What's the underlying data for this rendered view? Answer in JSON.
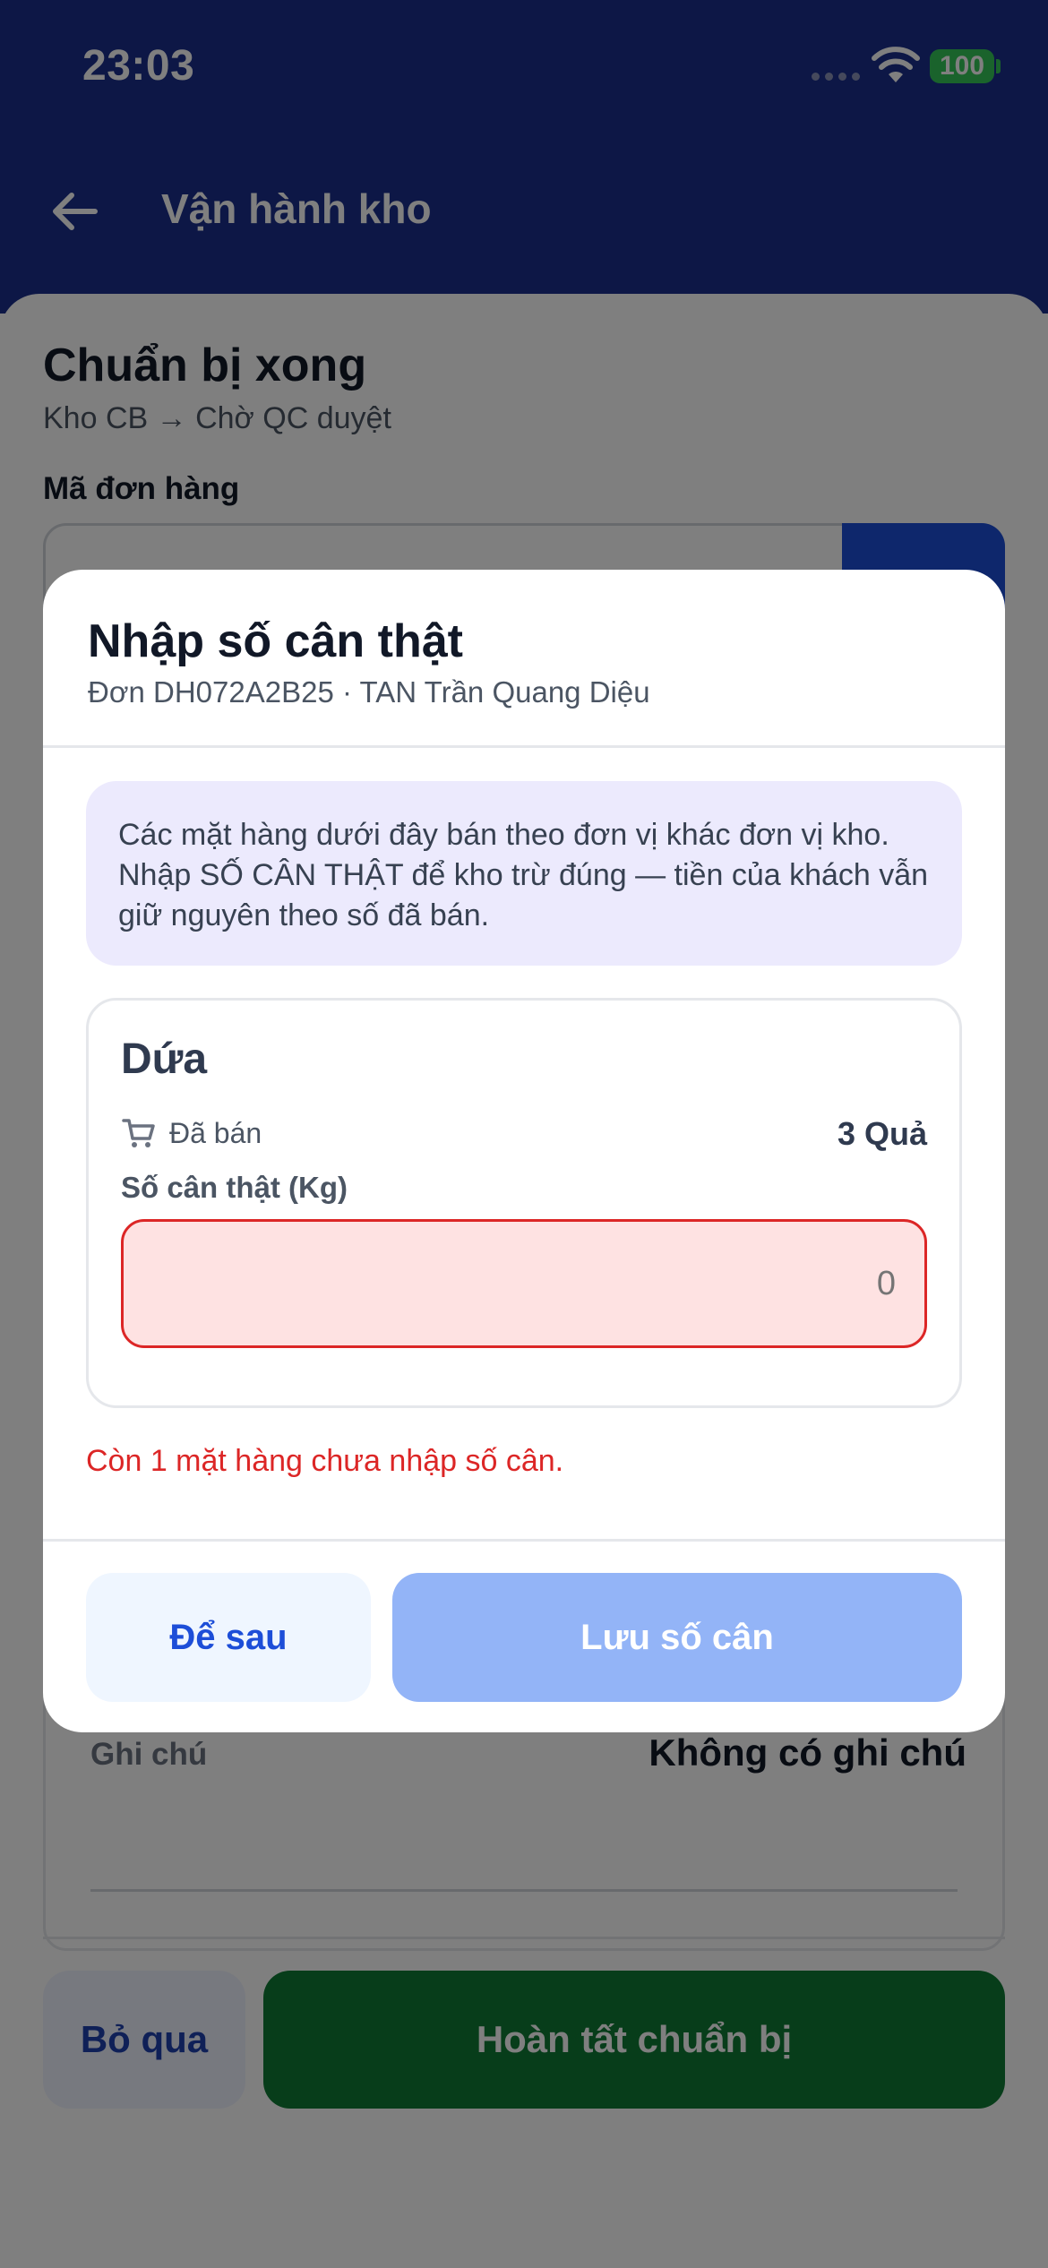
{
  "status_bar": {
    "time": "23:03",
    "battery": "100"
  },
  "header": {
    "title": "Vận hành kho"
  },
  "page": {
    "title": "Chuẩn bị xong",
    "subtitle": "Kho CB → Chờ QC duyệt",
    "order_label": "Mã đơn hàng",
    "note_label": "Ghi chú",
    "note_value": "Không có ghi chú",
    "skip_label": "Bỏ qua",
    "complete_label": "Hoàn tất chuẩn bị"
  },
  "modal": {
    "title": "Nhập số cân thật",
    "subtitle": "Đơn DH072A2B25 · TAN Trần Quang Diệu",
    "info": "Các mặt hàng dưới đây bán theo đơn vị khác đơn vị kho. Nhập SỐ CÂN THẬT để kho trừ đúng — tiền của khách vẫn giữ nguyên theo số đã bán.",
    "item": {
      "name": "Dứa",
      "sold_label": "Đã bán",
      "sold_value": "3 Quả",
      "weight_label": "Số cân thật (Kg)",
      "weight_placeholder": "0"
    },
    "warning": "Còn 1 mặt hàng chưa nhập số cân.",
    "later_label": "Để sau",
    "save_label": "Lưu số cân"
  }
}
